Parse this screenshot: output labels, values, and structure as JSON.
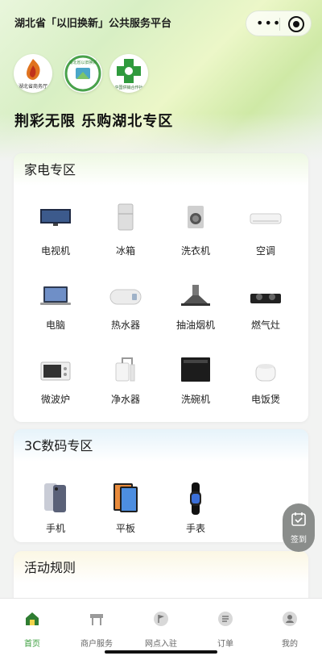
{
  "window": {
    "title": "湖北省「以旧换新」公共服务平台"
  },
  "header": {
    "slogan": "荆彩无限 乐购湖北专区"
  },
  "logos": [
    {
      "name": "hubei-commerce-logo",
      "caption": "湖北省商务厅"
    },
    {
      "name": "trade-in-logo",
      "caption": "湖北省以旧换新"
    },
    {
      "name": "supply-marketing-logo",
      "caption": "中国供销合作社"
    }
  ],
  "appliances": {
    "title": "家电专区",
    "items": [
      {
        "label": "电视机",
        "icon": "tv-icon"
      },
      {
        "label": "冰箱",
        "icon": "fridge-icon"
      },
      {
        "label": "洗衣机",
        "icon": "washer-icon"
      },
      {
        "label": "空调",
        "icon": "ac-icon"
      },
      {
        "label": "电脑",
        "icon": "laptop-icon"
      },
      {
        "label": "热水器",
        "icon": "water-heater-icon"
      },
      {
        "label": "抽油烟机",
        "icon": "range-hood-icon"
      },
      {
        "label": "燃气灶",
        "icon": "gas-stove-icon"
      },
      {
        "label": "微波炉",
        "icon": "microwave-icon"
      },
      {
        "label": "净水器",
        "icon": "water-purifier-icon"
      },
      {
        "label": "洗碗机",
        "icon": "dishwasher-icon"
      },
      {
        "label": "电饭煲",
        "icon": "rice-cooker-icon"
      }
    ]
  },
  "digital": {
    "title": "3C数码专区",
    "items": [
      {
        "label": "手机",
        "icon": "phone-icon"
      },
      {
        "label": "平板",
        "icon": "tablet-icon"
      },
      {
        "label": "手表",
        "icon": "watch-icon"
      }
    ]
  },
  "rules": {
    "title": "活动规则"
  },
  "float_button": {
    "label": "签到",
    "icon": "checkin-calendar-icon"
  },
  "tabbar": {
    "items": [
      {
        "label": "首页",
        "icon": "home-icon",
        "active": true
      },
      {
        "label": "商户服务",
        "icon": "shop-icon",
        "active": false
      },
      {
        "label": "网点入驻",
        "icon": "flag-icon",
        "active": false
      },
      {
        "label": "订单",
        "icon": "order-icon",
        "active": false
      },
      {
        "label": "我的",
        "icon": "user-icon",
        "active": false
      }
    ]
  },
  "colors": {
    "accent": "#3a9d3c",
    "hero": "#d8efc4"
  }
}
